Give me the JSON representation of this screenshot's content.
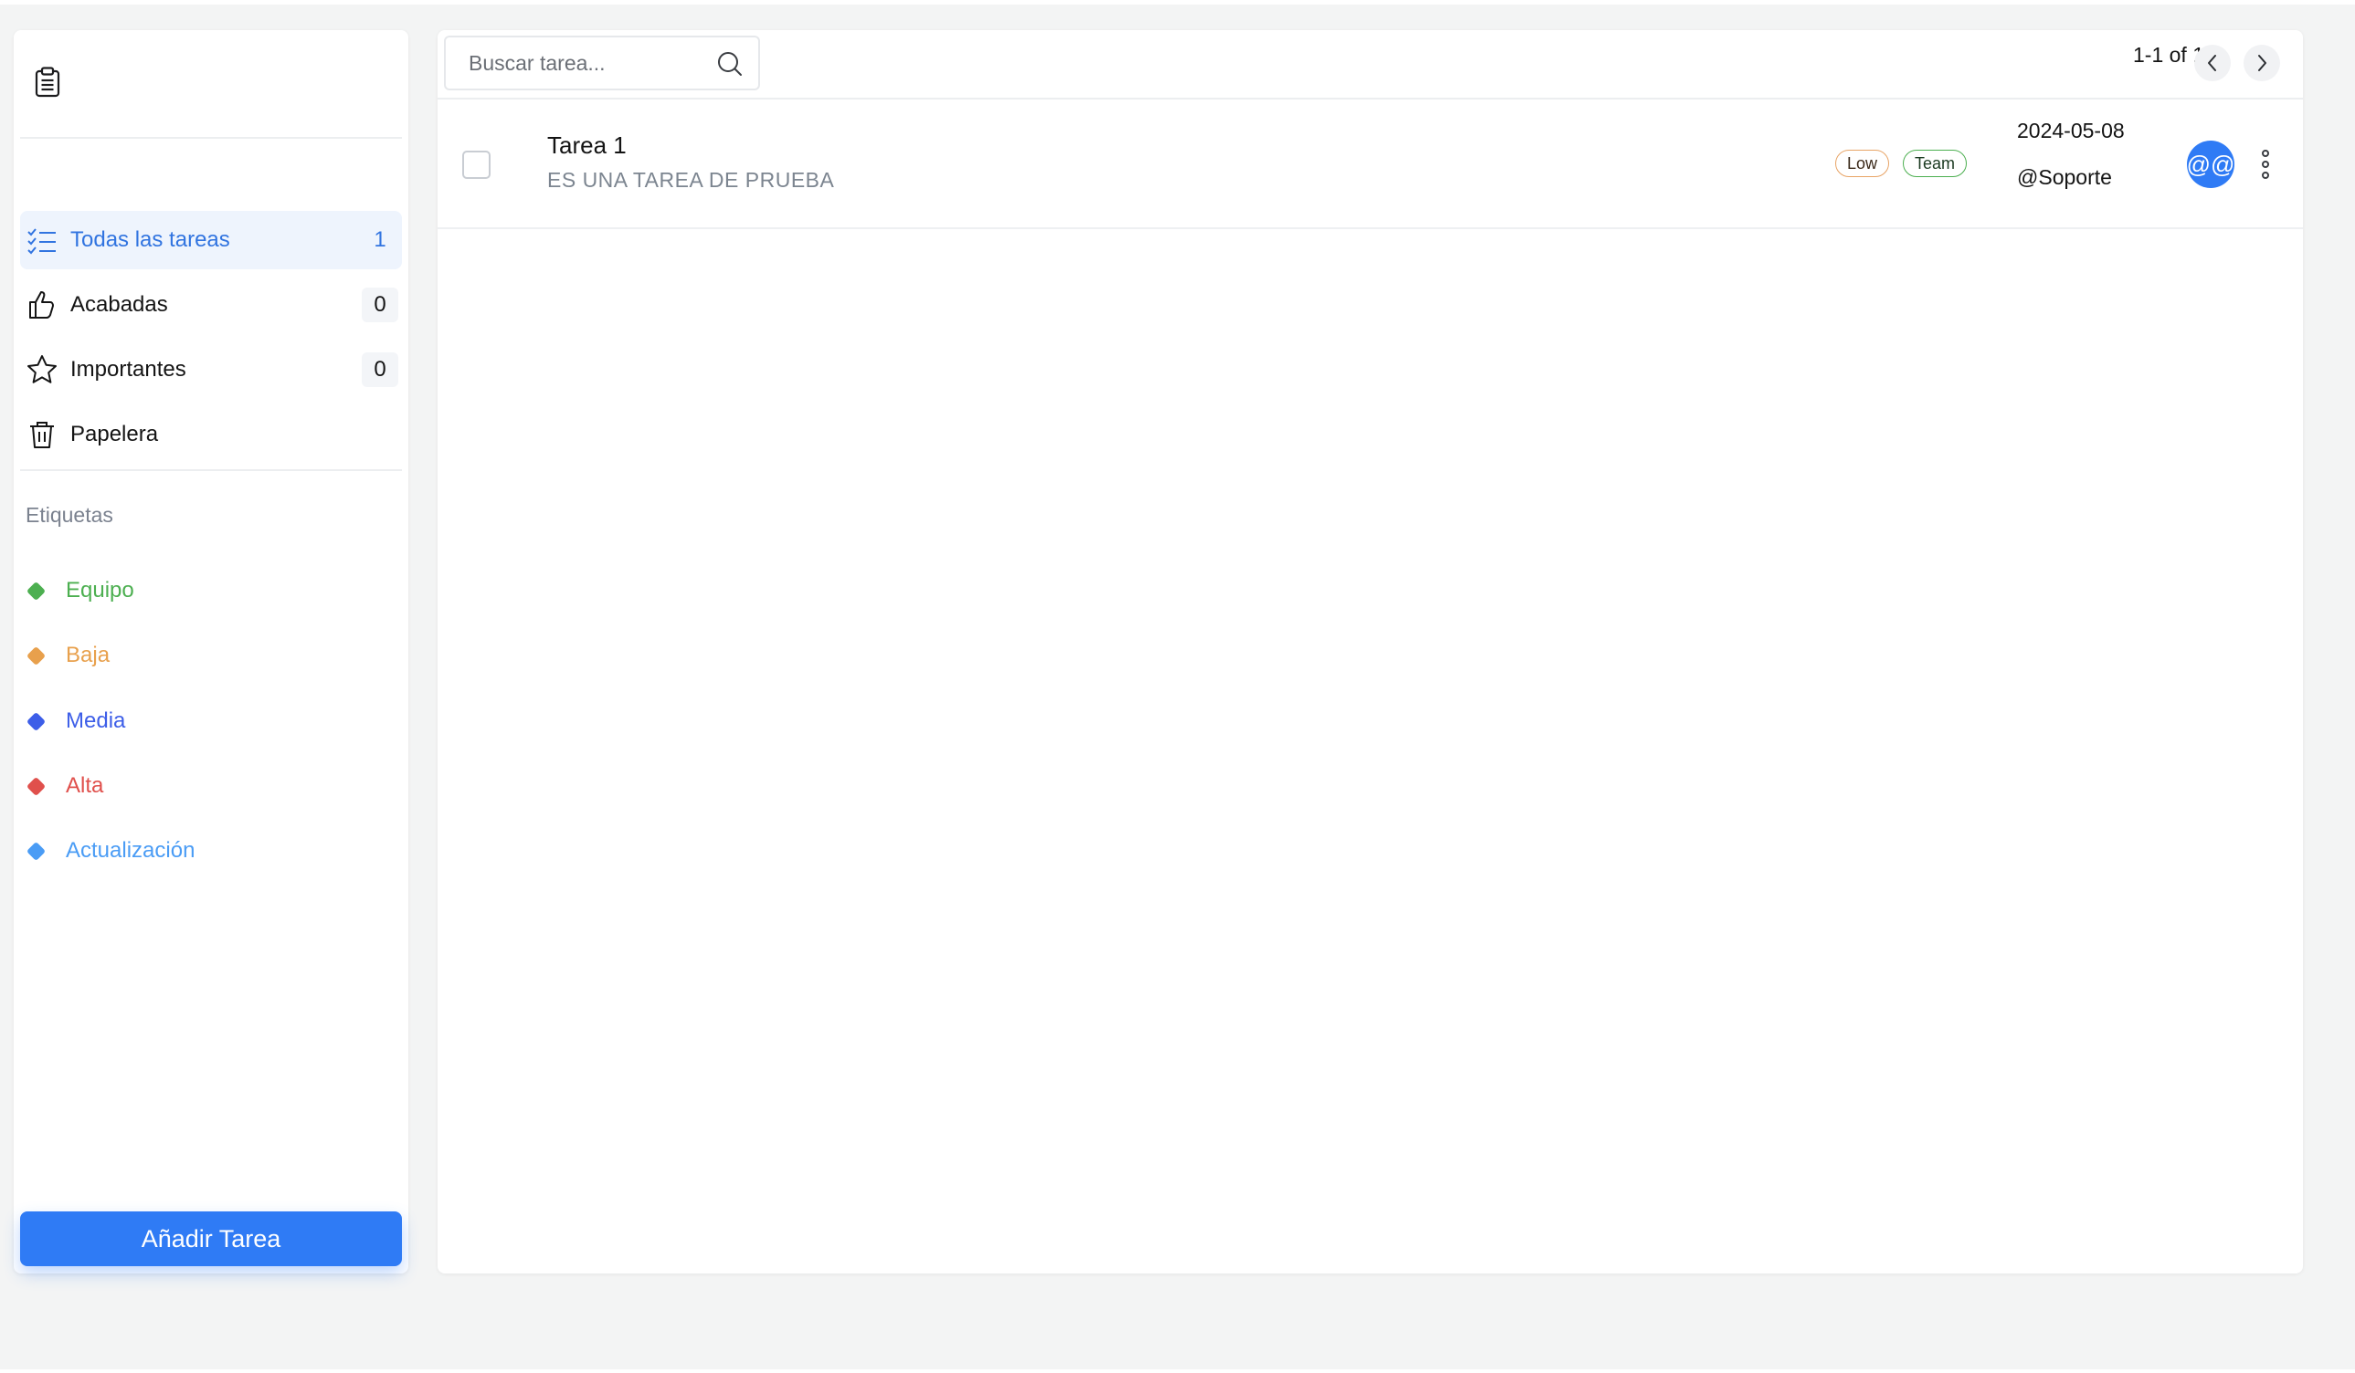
{
  "sidebar": {
    "nav": [
      {
        "label": "Todas las tareas",
        "count": "1",
        "icon": "list-check-icon",
        "active": true
      },
      {
        "label": "Acabadas",
        "count": "0",
        "icon": "thumbs-up-icon"
      },
      {
        "label": "Importantes",
        "count": "0",
        "icon": "star-icon"
      },
      {
        "label": "Papelera",
        "icon": "trash-icon"
      }
    ],
    "labels_heading": "Etiquetas",
    "labels": [
      {
        "label": "Equipo",
        "color": "#4caf50"
      },
      {
        "label": "Baja",
        "color": "#e8a04c"
      },
      {
        "label": "Media",
        "color": "#3d5ee8"
      },
      {
        "label": "Alta",
        "color": "#e0504c"
      },
      {
        "label": "Actualización",
        "color": "#4a9cf5"
      }
    ],
    "add_button": "Añadir Tarea"
  },
  "toolbar": {
    "search_placeholder": "Buscar tarea...",
    "pagination": "1-1 of 1"
  },
  "tasks": [
    {
      "title": "Tarea 1",
      "description": "ES UNA TAREA DE PRUEBA",
      "tags": [
        "Low",
        "Team"
      ],
      "date": "2024-05-08",
      "assignee": "@Soporte",
      "avatar_text": "@@"
    }
  ],
  "colors": {
    "accent": "#2f7bf5",
    "active_text": "#3174e0",
    "active_bg": "#eef4fd"
  }
}
